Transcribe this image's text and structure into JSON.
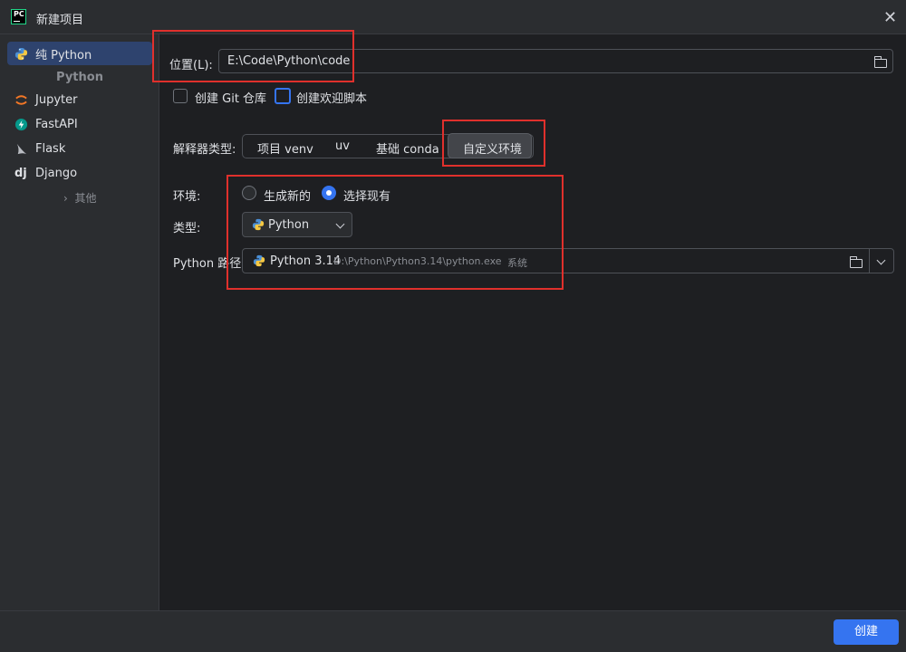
{
  "window": {
    "title": "新建项目",
    "app_icon_text": "PC"
  },
  "sidebar": {
    "items": [
      {
        "label": "纯 Python",
        "icon": "python-icon",
        "active": true
      },
      {
        "label": "Jupyter",
        "icon": "jupyter-icon"
      },
      {
        "label": "FastAPI",
        "icon": "fastapi-icon"
      },
      {
        "label": "Flask",
        "icon": "flask-icon"
      },
      {
        "label": "Django",
        "icon": "django-icon",
        "icon_text": "dj"
      }
    ],
    "group_header": "Python",
    "more_label": "其他"
  },
  "form": {
    "location": {
      "label": "位置(L):",
      "value": "E:\\Code\\Python\\code"
    },
    "checkboxes": [
      {
        "label": "创建 Git 仓库",
        "checked": false
      },
      {
        "label": "创建欢迎脚本",
        "checked": false
      }
    ],
    "interpreter_type": {
      "label": "解释器类型:",
      "options": [
        "项目 venv",
        "uv",
        "基础 conda",
        "自定义环境"
      ],
      "selected": "自定义环境"
    },
    "environment": {
      "label": "环境:",
      "options": [
        "生成新的",
        "选择现有"
      ],
      "selected": "选择现有"
    },
    "type": {
      "label": "类型:",
      "value": "Python"
    },
    "python_path": {
      "label": "Python 路径:",
      "version": "Python 3.14",
      "path": "D:\\Python\\Python3.14\\python.exe",
      "tag": "系统"
    }
  },
  "footer": {
    "create_label": "创建"
  },
  "colors": {
    "accent": "#3574f0",
    "background": "#1e1f22",
    "panel": "#2b2d30",
    "highlight_box": "#e0302c"
  }
}
